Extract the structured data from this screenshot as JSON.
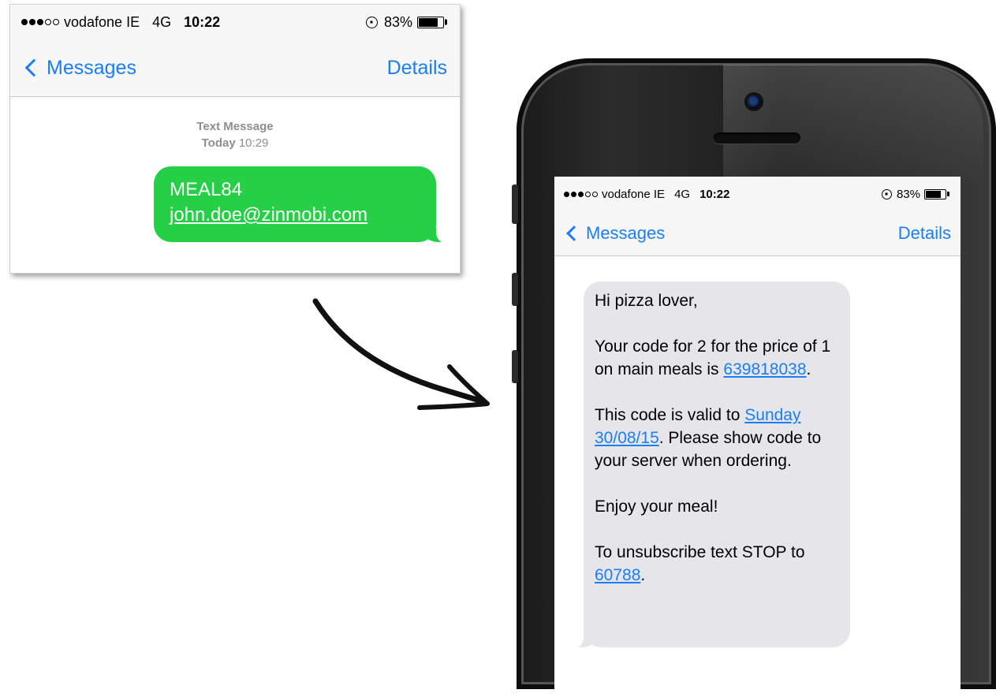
{
  "status_bar": {
    "carrier": "vodafone IE",
    "network": "4G",
    "time": "10:22",
    "battery": "83%",
    "battery_level": 0.83,
    "signal_bars_filled": 3,
    "signal_bars_total": 5,
    "icons": [
      "signal-dots-icon",
      "rotation-lock-icon",
      "battery-icon"
    ]
  },
  "sent_screen": {
    "nav": {
      "back_label": "Messages",
      "details_label": "Details"
    },
    "meta_type": "Text Message",
    "meta_day": "Today",
    "meta_time": "10:29",
    "bubble": {
      "line1": "MEAL84",
      "line2": "john.doe@zinmobi.com"
    }
  },
  "received_screen": {
    "nav": {
      "back_label": "Messages",
      "details_label": "Details"
    },
    "message": {
      "greeting": "Hi pizza lover,",
      "code_text": "Your code for 2 for the price of 1 on main meals is ",
      "code": "639818038",
      "code_suffix": ".",
      "valid_text": "This code is valid to ",
      "valid_date": "Sunday 30/08/15",
      "valid_suffix": ". Please show code to your server when ordering.",
      "enjoy": "Enjoy your meal!",
      "unsub_text": "To unsubscribe text STOP to ",
      "unsub_number": "60788",
      "unsub_suffix": "."
    }
  },
  "colors": {
    "ios_blue": "#1a7ef5",
    "sent_bubble": "#26d046",
    "received_bubble": "#e5e5ea"
  }
}
